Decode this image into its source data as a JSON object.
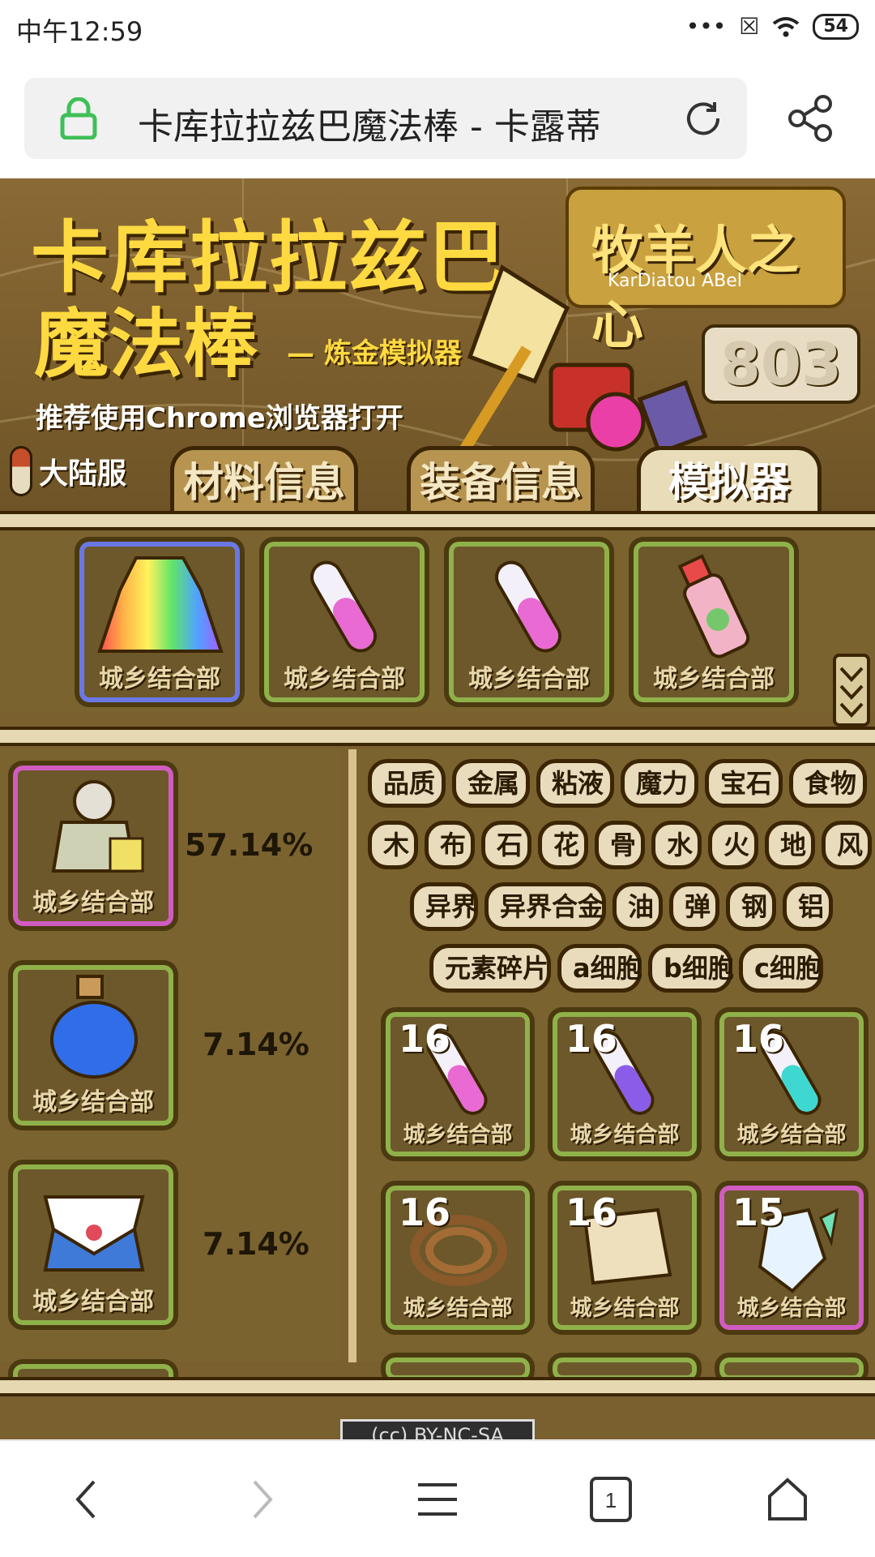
{
  "status_bar": {
    "time": "中午12:59",
    "battery": "54"
  },
  "browser": {
    "page_title": "卡库拉拉兹巴魔法棒 - 卡露蒂"
  },
  "banner": {
    "title_line1": "卡库拉拉兹巴",
    "title_line2": "魔法棒",
    "subtitle": "— 炼金模拟器",
    "recommend": "推荐使用Chrome浏览器打开",
    "logo_text": "牧羊人之心",
    "logo_sub": "KarDiatou ABel",
    "counter": "803",
    "server_label": "大陆服"
  },
  "tabs": [
    {
      "label": "材料信息"
    },
    {
      "label": "装备信息"
    },
    {
      "label": "模拟器"
    }
  ],
  "top_slots": [
    {
      "label": "城乡结合部",
      "icon": "rainbow-dress-icon",
      "border": "blue"
    },
    {
      "label": "城乡结合部",
      "icon": "pink-test-tube-icon",
      "border": "green"
    },
    {
      "label": "城乡结合部",
      "icon": "pink-test-tube-icon",
      "border": "green"
    },
    {
      "label": "城乡结合部",
      "icon": "potion-bottle-icon",
      "border": "green"
    }
  ],
  "results": [
    {
      "label": "城乡结合部",
      "icon": "armor-figure-icon",
      "percent": "57.14%",
      "border": "pink"
    },
    {
      "label": "城乡结合部",
      "icon": "blue-potion-icon",
      "percent": "7.14%",
      "border": "green"
    },
    {
      "label": "城乡结合部",
      "icon": "sailor-uniform-icon",
      "percent": "7.14%",
      "border": "green"
    }
  ],
  "filters": {
    "row1": [
      "品质",
      "金属",
      "粘液",
      "魔力",
      "宝石",
      "食物"
    ],
    "row2": [
      "木",
      "布",
      "石",
      "花",
      "骨",
      "水",
      "火",
      "地",
      "风"
    ],
    "row3": [
      "异界",
      "异界合金",
      "油",
      "弹",
      "钢",
      "铝"
    ],
    "row4": [
      "元素碎片",
      "a细胞",
      "b细胞",
      "c细胞"
    ]
  },
  "materials": [
    {
      "count": "16",
      "label": "城乡结合部",
      "icon": "pink-test-tube-icon",
      "border": "green"
    },
    {
      "count": "16",
      "label": "城乡结合部",
      "icon": "purple-test-tube-icon",
      "border": "green"
    },
    {
      "count": "16",
      "label": "城乡结合部",
      "icon": "cyan-test-tube-icon",
      "border": "green"
    },
    {
      "count": "16",
      "label": "城乡结合部",
      "icon": "rope-icon",
      "border": "green"
    },
    {
      "count": "16",
      "label": "城乡结合部",
      "icon": "cloth-icon",
      "border": "green"
    },
    {
      "count": "15",
      "label": "城乡结合部",
      "icon": "crystal-icon",
      "border": "pink"
    }
  ],
  "license": "BY-NC-SA",
  "colors": {
    "accent_yellow": "#ffd940",
    "panel_brown": "#7b6330",
    "green_border": "#8fb14a",
    "blue_border": "#6a78e6",
    "pink_border": "#d15cc1"
  }
}
